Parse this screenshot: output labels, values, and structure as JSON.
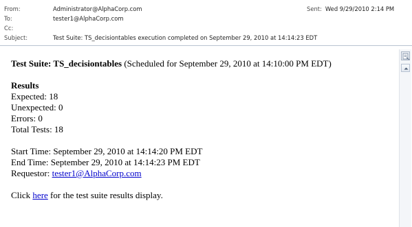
{
  "header": {
    "from_label": "From:",
    "from_value": "Administrator@AlphaCorp.com",
    "to_label": "To:",
    "to_value": "tester1@AlphaCorp.com",
    "cc_label": "Cc:",
    "cc_value": "",
    "subject_label": "Subject:",
    "subject_value": "Test Suite: TS_decisiontables execution completed on September 29, 2010 at 14:14:23 EDT",
    "sent_label": "Sent:",
    "sent_value": "Wed 9/29/2010 2:14 PM"
  },
  "message": {
    "suite_prefix": "Test Suite: ",
    "suite_name": "TS_decisiontables",
    "suite_schedule": " (Scheduled for September 29, 2010 at 14:10:00 PM EDT)",
    "results_heading": "Results",
    "expected": "Expected: 18",
    "unexpected": "Unexpected: 0",
    "errors": "Errors: 0",
    "total_tests": "Total Tests: 18",
    "start_time": "Start Time: September 29, 2010 at 14:14:20 PM EDT",
    "end_time": "End Time: September 29, 2010 at 14:14:23 PM EDT",
    "requestor_label": "Requestor: ",
    "requestor_email": "tester1@AlphaCorp.com",
    "click_prefix": "Click ",
    "here_link": "here",
    "click_suffix": " for the test suite results display."
  },
  "icons": {
    "scrollbar_top": "message-options-icon",
    "scroll_up": "scroll-up-arrow-icon"
  },
  "colors": {
    "link": "#0000cc",
    "header_label": "#4a4a4a",
    "divider": "#b9c3d1"
  }
}
